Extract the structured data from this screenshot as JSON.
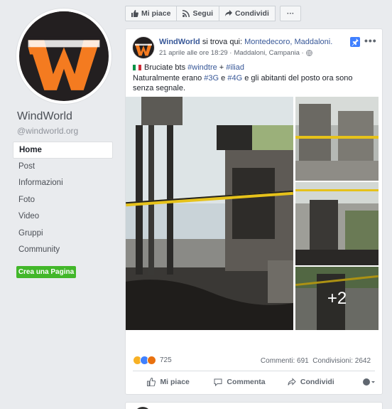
{
  "page": {
    "name": "WindWorld",
    "handle": "@windworld.org",
    "logo_letter": "W"
  },
  "nav": [
    {
      "label": "Home",
      "active": true
    },
    {
      "label": "Post"
    },
    {
      "label": "Informazioni"
    },
    {
      "label": "Foto"
    },
    {
      "label": "Video"
    },
    {
      "label": "Gruppi"
    },
    {
      "label": "Community"
    }
  ],
  "create_page_label": "Crea una Pagina",
  "toolbar": {
    "like": "Mi piace",
    "follow": "Segui",
    "share": "Condividi",
    "more": "···"
  },
  "post": {
    "author": "WindWorld",
    "location_prefix": "si trova qui:",
    "location": "Montedecoro, Maddaloni.",
    "date": "21 aprile alle ore 18:29 ·",
    "place": "Maddaloni, Campania ·",
    "line1_text": "Bruciate bts",
    "hashtag1": "#windtre",
    "plus": "+",
    "hashtag2": "#iliad",
    "line2_a": "Naturalmente erano",
    "hashtag3": "#3G",
    "line2_b": "e",
    "hashtag4": "#4G",
    "line2_c": "e gli abitanti del posto ora sono senza segnale.",
    "more_photos": "+2",
    "reactions_count": "725",
    "comments": "Commenti: 691",
    "shares": "Condivisioni: 2642",
    "action_like": "Mi piace",
    "action_comment": "Commenta",
    "action_share": "Condividi"
  },
  "colors": {
    "accent": "#385898",
    "green": "#42b72a",
    "logo_orange": "#f47b20",
    "logo_dark": "#231f20"
  }
}
